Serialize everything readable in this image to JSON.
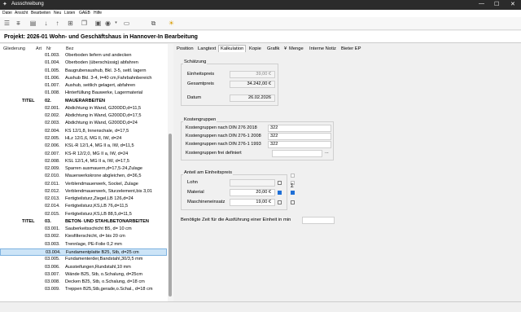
{
  "window": {
    "title": "Ausschreibung"
  },
  "menu": [
    "Datei",
    "Ansicht",
    "Bearbeiten",
    "Neu",
    "Listen",
    "GAEB",
    "Hilfe"
  ],
  "toolbar_icons": [
    "list-icon",
    "filter-icon",
    "stack-icon",
    "arrow-down-icon",
    "arrow-up-icon",
    "tree-icon",
    "image-icon",
    "globe-icon",
    "window-icon",
    "copy-icon",
    "bulb-icon"
  ],
  "project": {
    "label": "Projekt:  2026-01 Wohn- und Geschäftshaus in Hannover-In Bearbeitung"
  },
  "list": {
    "headers": {
      "gliederung": "Gliederung",
      "art": "Art",
      "nr": "Nr",
      "bez": "Bez"
    },
    "rows": [
      {
        "label": "",
        "nr": "01.003.",
        "bez": "Oberboden liefern und andecken",
        "bold": false
      },
      {
        "label": "",
        "nr": "01.004.",
        "bez": "Oberboden (überschüssig) abfahren",
        "bold": false
      },
      {
        "label": "",
        "nr": "01.005.",
        "bez": "Baugrubenaushub, Bkl. 3-5, seitl. lagern",
        "bold": false
      },
      {
        "label": "",
        "nr": "01.006.",
        "bez": "Aushub Bkl. 3-4, t=40 cm,Fahrbahnbereich",
        "bold": false
      },
      {
        "label": "",
        "nr": "01.007.",
        "bez": "Aushub, seitlich gelagert, abfahren",
        "bold": false
      },
      {
        "label": "",
        "nr": "01.008.",
        "bez": "Hinterfüllung Bauwerke, Lagermaterial",
        "bold": false
      },
      {
        "label": "TITEL",
        "nr": "02.",
        "bez": "MAUERARBEITEN",
        "bold": true
      },
      {
        "label": "",
        "nr": "02.001.",
        "bez": "Abdichtung in Wand, G200DD,d=11,5",
        "bold": false
      },
      {
        "label": "",
        "nr": "02.002.",
        "bez": "Abdichtung in Wand, G200DD,d=17,5",
        "bold": false
      },
      {
        "label": "",
        "nr": "02.003.",
        "bez": "Abdichtung in Wand, G200DD,d=24",
        "bold": false
      },
      {
        "label": "",
        "nr": "02.004.",
        "bez": "KS 12/1,8, Innenschale, d=17,5",
        "bold": false
      },
      {
        "label": "",
        "nr": "02.005.",
        "bez": "HLz 12/1,6, MG II, IW, d=24",
        "bold": false
      },
      {
        "label": "",
        "nr": "02.006.",
        "bez": "KSL-R 12/1,4, MG II a, IW, d=11,5",
        "bold": false
      },
      {
        "label": "",
        "nr": "02.007.",
        "bez": "KS-R 12/2,0, MG II a, IW, d=24",
        "bold": false
      },
      {
        "label": "",
        "nr": "02.008.",
        "bez": "KSL 12/1,4, MG II a, IW, d=17,5",
        "bold": false
      },
      {
        "label": "",
        "nr": "02.009.",
        "bez": "Sparren ausmauern,d=17,5-24,Zulage",
        "bold": false
      },
      {
        "label": "",
        "nr": "02.010.",
        "bez": "Mauerwerkskrone abgleichen, d=36,5",
        "bold": false
      },
      {
        "label": "",
        "nr": "02.011.",
        "bez": "Verblendmauerwerk, Sockel, Zulage",
        "bold": false
      },
      {
        "label": "",
        "nr": "02.012.",
        "bez": "Verblendmauerwerk, Sturzelement,bis 3,01",
        "bold": false
      },
      {
        "label": "",
        "nr": "02.013.",
        "bez": "Fertigteilsturz,Ziegel,LB 126,d=24",
        "bold": false
      },
      {
        "label": "",
        "nr": "02.014.",
        "bez": "Fertigteilsturz,KS,LB 76,d=11,5",
        "bold": false
      },
      {
        "label": "",
        "nr": "02.015.",
        "bez": "Fertigteilsturz,KS,LB 88,5,d=11,5",
        "bold": false
      },
      {
        "label": "TITEL",
        "nr": "03.",
        "bez": "BETON- UND STAHLBETONARBEITEN",
        "bold": true
      },
      {
        "label": "",
        "nr": "03.001.",
        "bez": "Sauberkeitsschicht B5, d= 10 cm",
        "bold": false
      },
      {
        "label": "",
        "nr": "03.002.",
        "bez": "Kiesfilterschicht, d= bis 20 cm",
        "bold": false
      },
      {
        "label": "",
        "nr": "03.003.",
        "bez": "Trennlage, PE-Folie 0,2 mm",
        "bold": false
      },
      {
        "label": "",
        "nr": "03.004.",
        "bez": "Fundamentplatte B25, Stb, d=25 cm",
        "bold": false,
        "selected": true
      },
      {
        "label": "",
        "nr": "03.005.",
        "bez": "Fundamenterder,Bandstahl,30/3,5 mm",
        "bold": false
      },
      {
        "label": "",
        "nr": "03.006.",
        "bez": "Aussteifungen,Rundstahl,10 mm",
        "bold": false
      },
      {
        "label": "",
        "nr": "03.007.",
        "bez": "Wände B25, Stb, o.Schalung, d=25cm",
        "bold": false
      },
      {
        "label": "",
        "nr": "03.008.",
        "bez": "Decken B25, Stb, o.Schalung, d=18 cm",
        "bold": false
      },
      {
        "label": "",
        "nr": "03.009.",
        "bez": "Treppen B25,Stb,gerade,o.Schal., d=18 cm",
        "bold": false
      }
    ]
  },
  "tabs": [
    "Position",
    "Langtext",
    "Kalkulation",
    "Kopie",
    "Grafik",
    "Menge",
    "Interne Notiz",
    "Bieter EP"
  ],
  "tab_extra": {
    "menge_prefix": "¥"
  },
  "schaetzung": {
    "title": "Schätzung",
    "einheitspreis_label": "Einheitspreis",
    "einheitspreis_value": "39,00 €",
    "gesamtpreis_label": "Gesamtpreis",
    "gesamtpreis_value": "34.242,00 €",
    "datum_label": "Datum",
    "datum_value": "26.02.2026"
  },
  "kostengruppen": {
    "title": "Kostengruppen",
    "rows": [
      {
        "label": "Kostengruppen nach DIN 276 2018",
        "value": "322"
      },
      {
        "label": "Kostengruppen nach DIN 276-1 2008",
        "value": "322"
      },
      {
        "label": "Kostengruppen nach DIN 276-1 1993",
        "value": "322"
      },
      {
        "label": "Kostengruppen frei definiert",
        "value": ""
      }
    ],
    "ellipsis": "..."
  },
  "anteil": {
    "title": "Anteil am Einheitspreis",
    "sigma": "Σ",
    "rows": [
      {
        "label": "Lohn",
        "value": "",
        "checked": false
      },
      {
        "label": "Material",
        "value": "20,00 €",
        "checked": true
      },
      {
        "label": "Maschineneinsatz",
        "value": "19,00 €",
        "checked": false
      }
    ]
  },
  "zeit": {
    "label": "Benötigte Zeit für die Ausführung einer Einheit in min",
    "value": ""
  }
}
